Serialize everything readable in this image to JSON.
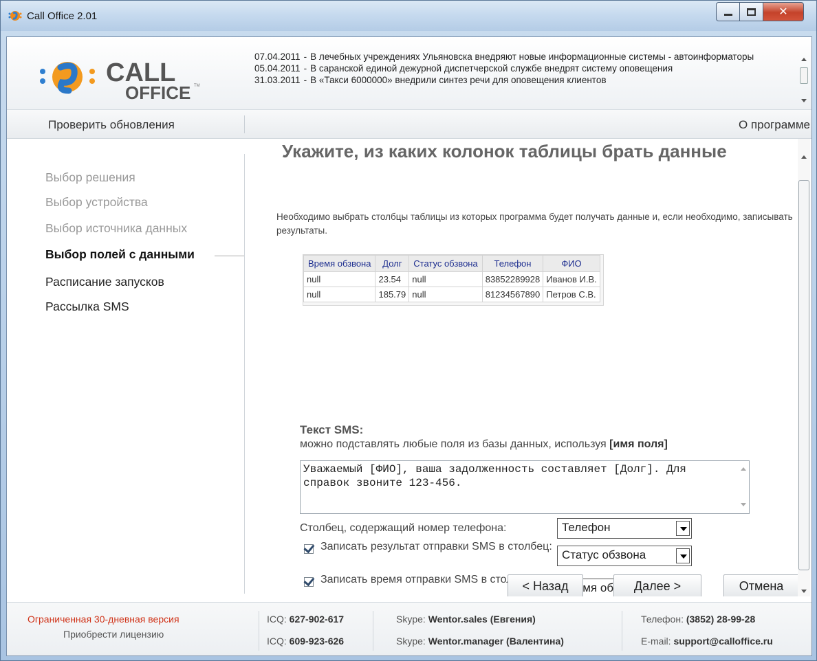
{
  "window": {
    "title": "Call Office 2.01"
  },
  "logo": {
    "line1": "CALL",
    "line2": "OFFICE",
    "tm": "TM"
  },
  "news": [
    {
      "date": "07.04.2011",
      "sep": "-",
      "text": "В лечебных учреждениях Ульяновска внедряют новые информационные системы - автоинформаторы"
    },
    {
      "date": "05.04.2011",
      "sep": "-",
      "text": "В саранской единой дежурной диспетчерской службе внедрят систему оповещения"
    },
    {
      "date": "31.03.2011",
      "sep": "-",
      "text": "В «Такси 6000000» внедрили синтез речи для оповещения клиентов"
    }
  ],
  "toolbar": {
    "check_updates": "Проверить обновления",
    "about": "О программе"
  },
  "sidebar": {
    "steps": [
      {
        "label": "Выбор решения"
      },
      {
        "label": "Выбор устройства"
      },
      {
        "label": "Выбор источника данных"
      },
      {
        "label": "Выбор полей с данными"
      },
      {
        "label": "Расписание запусков"
      },
      {
        "label": "Рассылка SMS"
      }
    ]
  },
  "main": {
    "heading": "Укажите, из каких колонок таблицы брать данные",
    "intro": "Необходимо выбрать столбцы таблицы из которых программа будет получать данные и, если необходимо, записывать результаты.",
    "table": {
      "headers": [
        "Время обзвона",
        "Долг",
        "Статус обзвона",
        "Телефон",
        "ФИО"
      ],
      "rows": [
        [
          "null",
          "23.54",
          "null",
          "83852289928",
          "Иванов И.В."
        ],
        [
          "null",
          "185.79",
          "null",
          "81234567890",
          "Петров С.В."
        ]
      ]
    },
    "sms": {
      "title": "Текст SMS:",
      "hint_prefix": "можно подставлять любые поля из базы данных, используя ",
      "hint_bold": "[имя поля]",
      "text": "Уважаемый [ФИО], ваша задолженность составляет [Долг]. Для справок звоните 123-456."
    },
    "phone_column": {
      "label": "Столбец, содержащий номер телефона:",
      "value": "Телефон"
    },
    "write_result": {
      "checked": true,
      "label": "Записать результат отправки SMS в столбец:",
      "value": "Статус обзвона"
    },
    "write_time": {
      "checked": true,
      "label": "Записать время отправки SMS в столбец:",
      "value": "Время обзвона"
    },
    "buttons": {
      "back": "< Назад",
      "next": "Далее >",
      "cancel": "Отмена"
    }
  },
  "footer": {
    "trial": "Ограниченная 30-дневная версия",
    "buy": "Приобрести лицензию",
    "icq_label": "ICQ:",
    "icq1": "627-902-617",
    "icq2": "609-923-626",
    "skype_label": "Skype:",
    "skype1": "Wentor.sales (Евгения)",
    "skype2": "Wentor.manager (Валентина)",
    "phone_label": "Телефон:",
    "phone": "(3852) 28-99-28",
    "email_label": "E-mail:",
    "email": "support@calloffice.ru"
  },
  "colors": {
    "accent_red": "#d0341a",
    "table_header_text": "#1c2d8f",
    "titlebar": "#c5d9ee"
  },
  "icons": [
    "app-logo-icon",
    "minimize-icon",
    "maximize-icon",
    "close-icon",
    "checkbox-checked-icon",
    "dropdown-arrow-icon",
    "scroll-up-icon",
    "scroll-down-icon"
  ]
}
